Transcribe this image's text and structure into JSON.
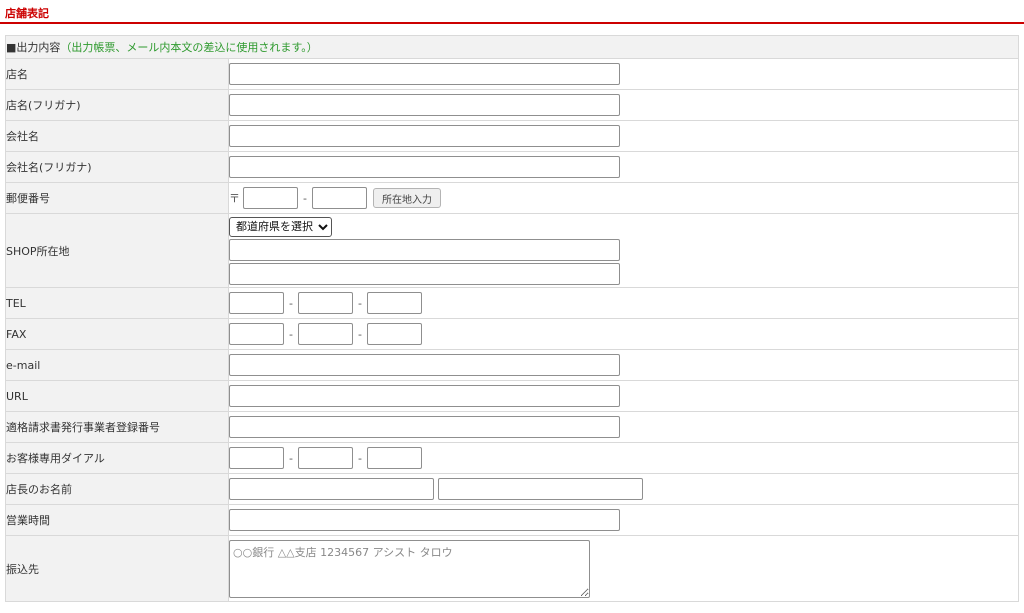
{
  "section": {
    "title": "店舗表記"
  },
  "caption": {
    "lead": "■出力内容",
    "note": "（出力帳票、メール内本文の差込に使用されます。）"
  },
  "labels": {
    "shop_name": "店名",
    "shop_name_kana": "店名(フリガナ)",
    "company": "会社名",
    "company_kana": "会社名(フリガナ)",
    "postal": "郵便番号",
    "address": "SHOP所在地",
    "tel": "TEL",
    "fax": "FAX",
    "email": "e-mail",
    "url": "URL",
    "invoice": "適格請求書発行事業者登録番号",
    "customer_dial": "お客様専用ダイアル",
    "manager_name": "店長のお名前",
    "business_hours": "営業時間",
    "bank": "振込先"
  },
  "postal": {
    "mark": "〒",
    "separator": "-",
    "lookup_button": "所在地入力"
  },
  "address": {
    "prefecture_select": "都道府県を選択"
  },
  "phone_separator": "-",
  "bank": {
    "placeholder": "○○銀行 △△支店 1234567 アシスト タロウ"
  },
  "colors": {
    "accent": "#cc0000",
    "note": "#2e9a2e",
    "label_bg": "#f2f2f2",
    "border": "#d9d9d9"
  }
}
